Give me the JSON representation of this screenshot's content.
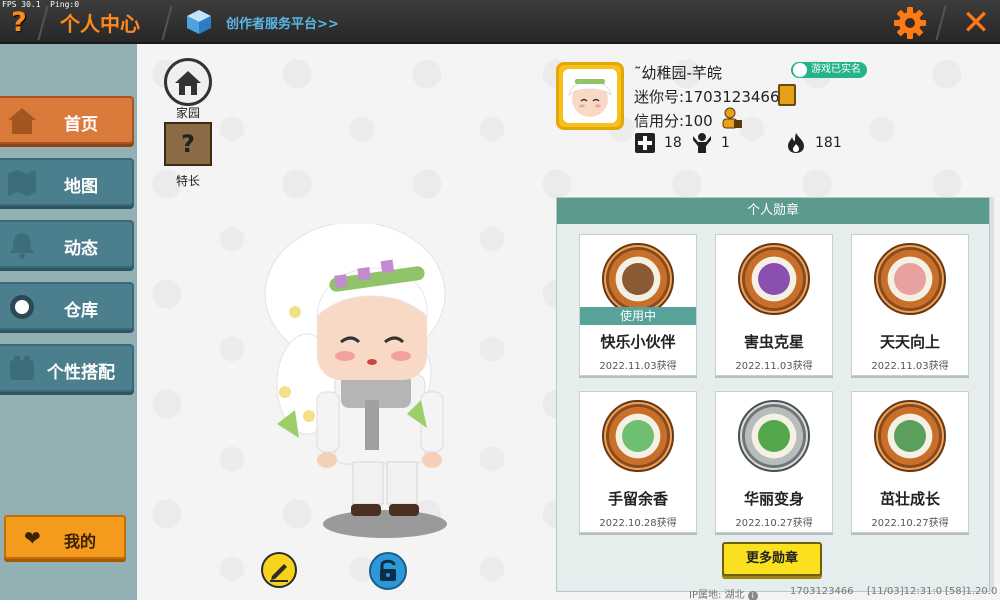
{
  "debug": {
    "fps_text": "FPS 30.1  Ping:0"
  },
  "header": {
    "title": "个人中心",
    "creator_link": "创作者服务平台>>"
  },
  "sidebar": {
    "items": [
      {
        "label": "首页",
        "active": true
      },
      {
        "label": "地图",
        "active": false
      },
      {
        "label": "动态",
        "active": false
      },
      {
        "label": "仓库",
        "active": false
      },
      {
        "label": "个性搭配",
        "active": false
      }
    ],
    "my_button": "我的"
  },
  "quick": {
    "home_label": "家园",
    "skill_label": "特长"
  },
  "profile": {
    "name": "˜幼稚园-芊皖",
    "verified_badge": "游戏已实名",
    "id_text": "迷你号:1703123466",
    "credit_text": "信用分:100",
    "stats": {
      "add": "18",
      "fans": "1",
      "hot": "181"
    }
  },
  "badges": {
    "title": "个人勋章",
    "in_use_label": "使用中",
    "items": [
      {
        "name": "快乐小伙伴",
        "date": "2022.11.03获得",
        "in_use": true,
        "color": "#8a5a34"
      },
      {
        "name": "害虫克星",
        "date": "2022.11.03获得",
        "in_use": false,
        "color": "#8b4fb0"
      },
      {
        "name": "天天向上",
        "date": "2022.11.03获得",
        "in_use": false,
        "color": "#e8a0a0"
      },
      {
        "name": "手留余香",
        "date": "2022.10.28获得",
        "in_use": false,
        "color": "#6fbf73"
      },
      {
        "name": "华丽变身",
        "date": "2022.10.27获得",
        "in_use": false,
        "color": "#52a84a"
      },
      {
        "name": "茁壮成长",
        "date": "2022.10.27获得",
        "in_use": false,
        "color": "#5aa05c"
      }
    ],
    "more_button": "更多勋章"
  },
  "footer": {
    "ip": "IP属地: 湖北",
    "uid": "1703123466",
    "time": "[11/03]12:31:0",
    "version": "[58]1.20.0"
  },
  "colors": {
    "accent_orange": "#ff8a1a",
    "sidebar_teal": "#4c7f8e",
    "active_orange": "#d9793a",
    "panel_header": "#5d9a8e",
    "more_yellow": "#fae01e"
  },
  "icons": [
    "help-icon",
    "cube-icon",
    "gear-icon",
    "close-icon",
    "home-icon",
    "question-block-icon",
    "pencil-icon",
    "lock-icon",
    "copy-icon",
    "heart-icon"
  ]
}
